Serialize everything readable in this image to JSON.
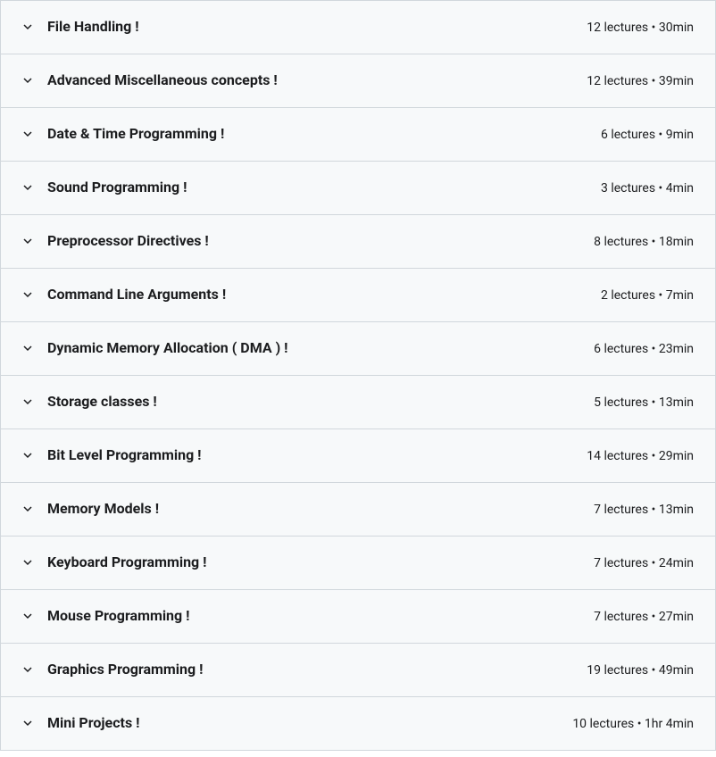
{
  "sections": [
    {
      "title": "File Handling !",
      "lectures": "12 lectures",
      "duration": "30min"
    },
    {
      "title": "Advanced Miscellaneous concepts !",
      "lectures": "12 lectures",
      "duration": "39min"
    },
    {
      "title": "Date & Time Programming !",
      "lectures": "6 lectures",
      "duration": "9min"
    },
    {
      "title": "Sound Programming !",
      "lectures": "3 lectures",
      "duration": "4min"
    },
    {
      "title": "Preprocessor Directives !",
      "lectures": "8 lectures",
      "duration": "18min"
    },
    {
      "title": "Command Line Arguments !",
      "lectures": "2 lectures",
      "duration": "7min"
    },
    {
      "title": "Dynamic Memory Allocation ( DMA ) !",
      "lectures": "6 lectures",
      "duration": "23min"
    },
    {
      "title": "Storage classes !",
      "lectures": "5 lectures",
      "duration": "13min"
    },
    {
      "title": "Bit Level Programming !",
      "lectures": "14 lectures",
      "duration": "29min"
    },
    {
      "title": "Memory Models !",
      "lectures": "7 lectures",
      "duration": "13min"
    },
    {
      "title": "Keyboard Programming !",
      "lectures": "7 lectures",
      "duration": "24min"
    },
    {
      "title": "Mouse Programming !",
      "lectures": "7 lectures",
      "duration": "27min"
    },
    {
      "title": "Graphics Programming !",
      "lectures": "19 lectures",
      "duration": "49min"
    },
    {
      "title": "Mini Projects !",
      "lectures": "10 lectures",
      "duration": "1hr 4min"
    }
  ],
  "separator": " • "
}
